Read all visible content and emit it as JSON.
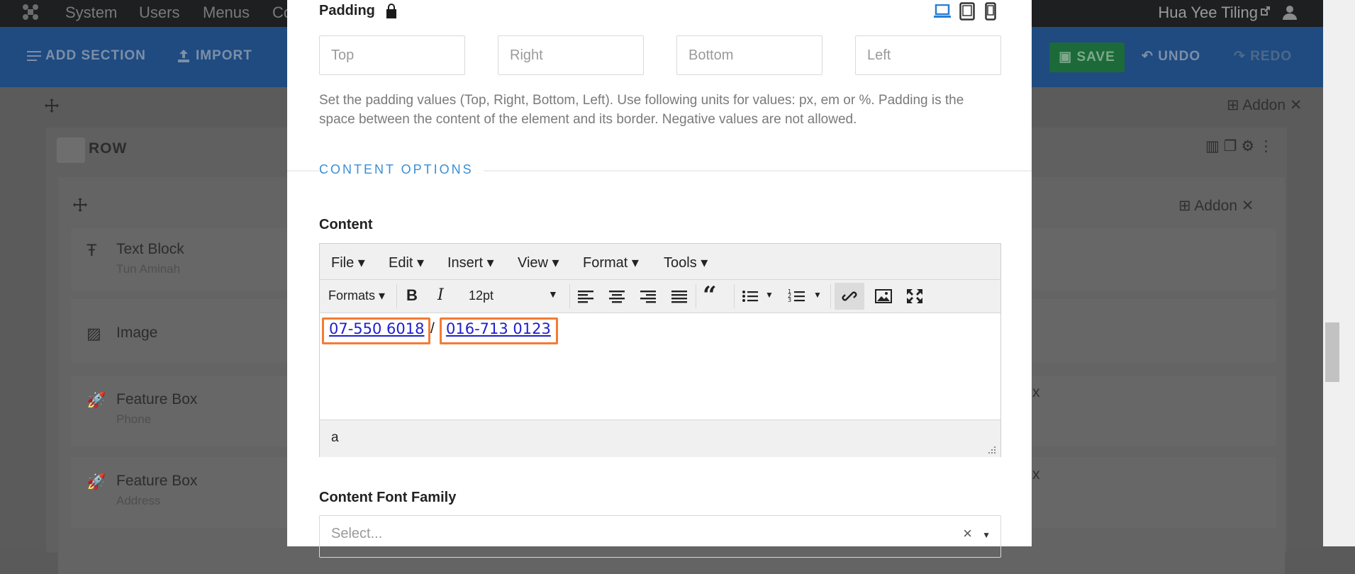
{
  "topnav": {
    "items": [
      "System",
      "Users",
      "Menus",
      "Co"
    ],
    "user_name": "Hua Yee Tiling"
  },
  "toolbar": {
    "add_section": "ADD SECTION",
    "import": "IMPORT",
    "save": "SAVE",
    "undo": "UNDO",
    "redo": "REDO"
  },
  "page": {
    "row_label": "ROW",
    "addon_label": "Addon",
    "addons": [
      {
        "title": "Text Block",
        "subtitle": "Tun Aminah"
      },
      {
        "title": "Image",
        "subtitle": ""
      },
      {
        "title": "Feature Box",
        "subtitle": "Phone"
      },
      {
        "title": "Feature Box",
        "subtitle": "Address"
      }
    ]
  },
  "modal": {
    "padding": {
      "label": "Padding",
      "top_placeholder": "Top",
      "right_placeholder": "Right",
      "bottom_placeholder": "Bottom",
      "left_placeholder": "Left",
      "help": "Set the padding values (Top, Right, Bottom, Left). Use following units for values: px, em or %. Padding is the space between the content of the element and its border. Negative values are not allowed."
    },
    "section_title": "CONTENT OPTIONS",
    "content": {
      "label": "Content",
      "menus": [
        "File",
        "Edit",
        "Insert",
        "View",
        "Format",
        "Tools"
      ],
      "formats_label": "Formats",
      "font_size": "12pt",
      "phone1": "07-550 6018",
      "separator": "/",
      "phone2": "016-713 0123",
      "status_path": "a"
    },
    "font_family": {
      "label": "Content Font Family",
      "placeholder": "Select..."
    }
  },
  "colors": {
    "accent": "#3a8fd5",
    "highlight": "#f47b35",
    "link": "#2020cc"
  }
}
